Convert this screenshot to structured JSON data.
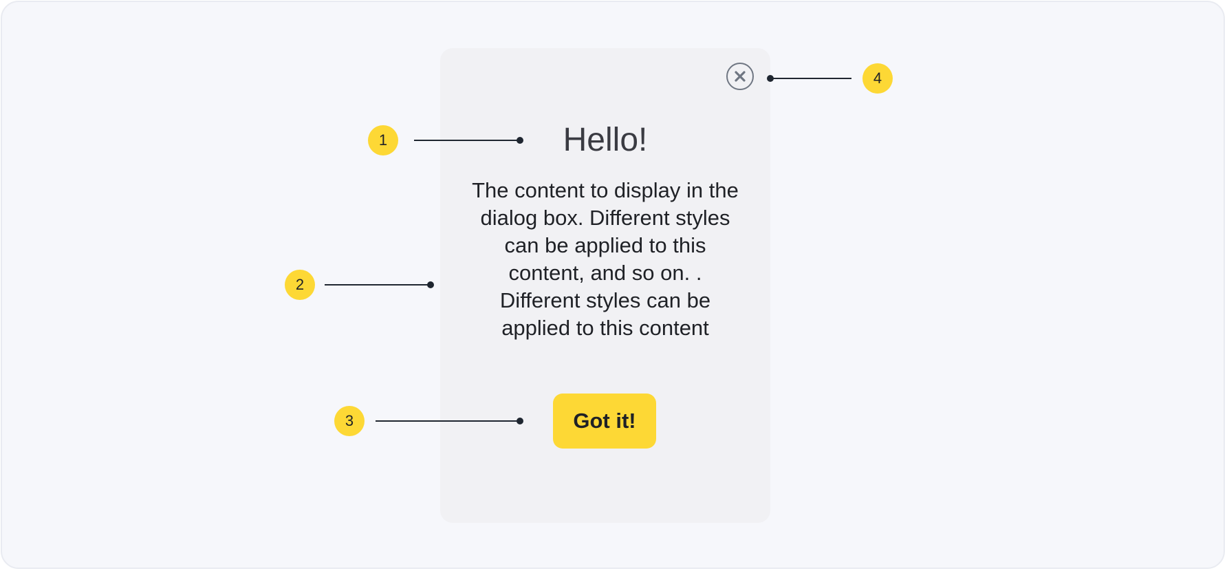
{
  "dialog": {
    "title": "Hello!",
    "content": "The content to display in the dialog box. Different styles can be applied to this content, and so on. . Different styles can be applied to this content",
    "button_label": "Got it!",
    "close_icon": "close-icon"
  },
  "callouts": {
    "title_marker": "1",
    "content_marker": "2",
    "button_marker": "3",
    "close_marker": "4"
  },
  "colors": {
    "accent": "#fdd835",
    "dialog_background": "#f1f1f4",
    "page_background": "#f6f7fb",
    "close_border": "#6f7682"
  }
}
